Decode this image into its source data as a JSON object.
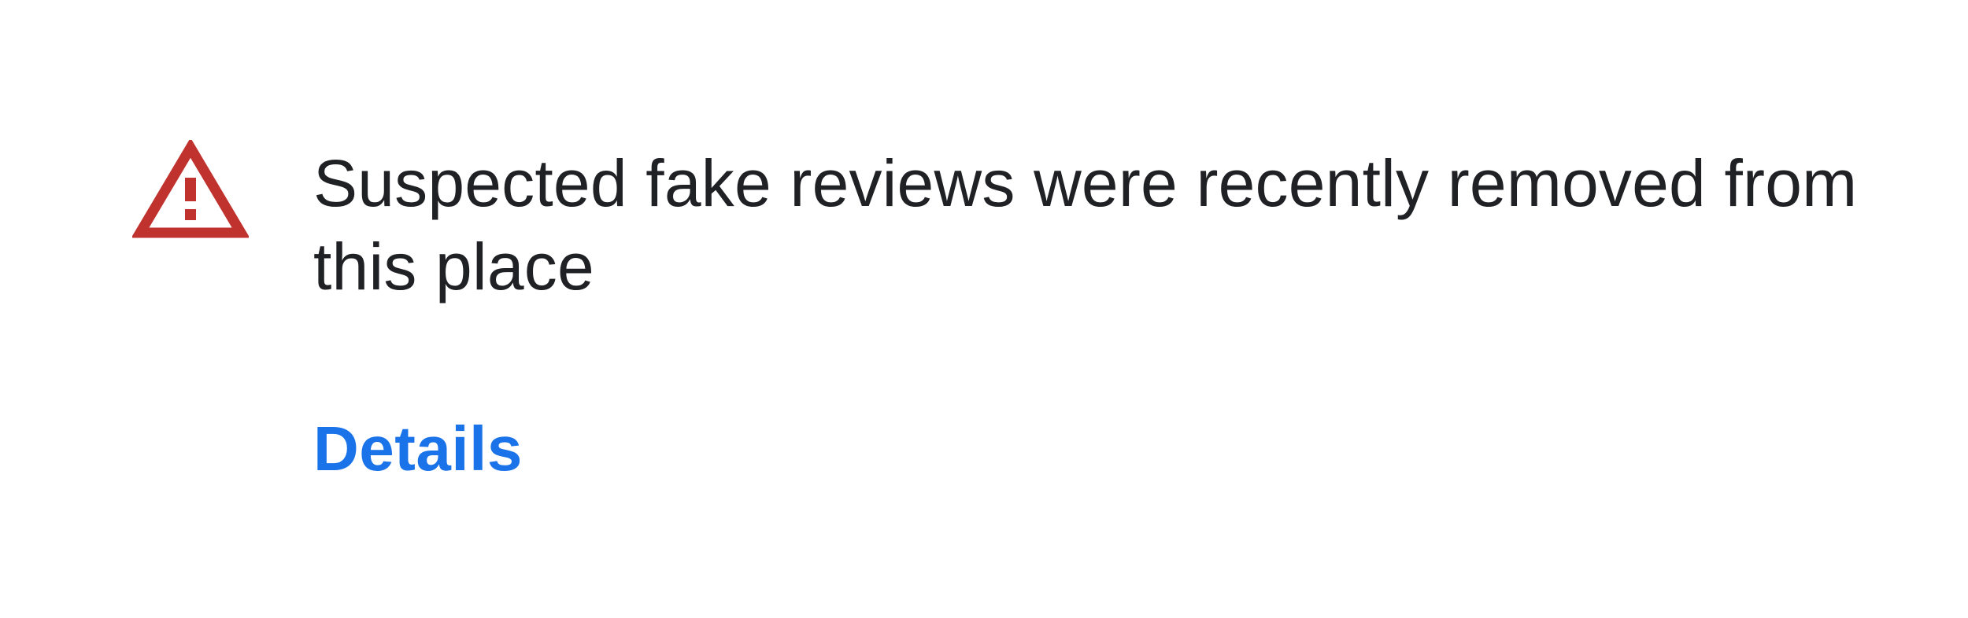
{
  "notice": {
    "icon": "warning-triangle-icon",
    "message": "Suspected fake reviews were recently removed from this place",
    "details_label": "Details"
  },
  "colors": {
    "warning": "#c0322e",
    "text": "#202124",
    "link": "#1a73e8",
    "background": "#ffffff"
  }
}
